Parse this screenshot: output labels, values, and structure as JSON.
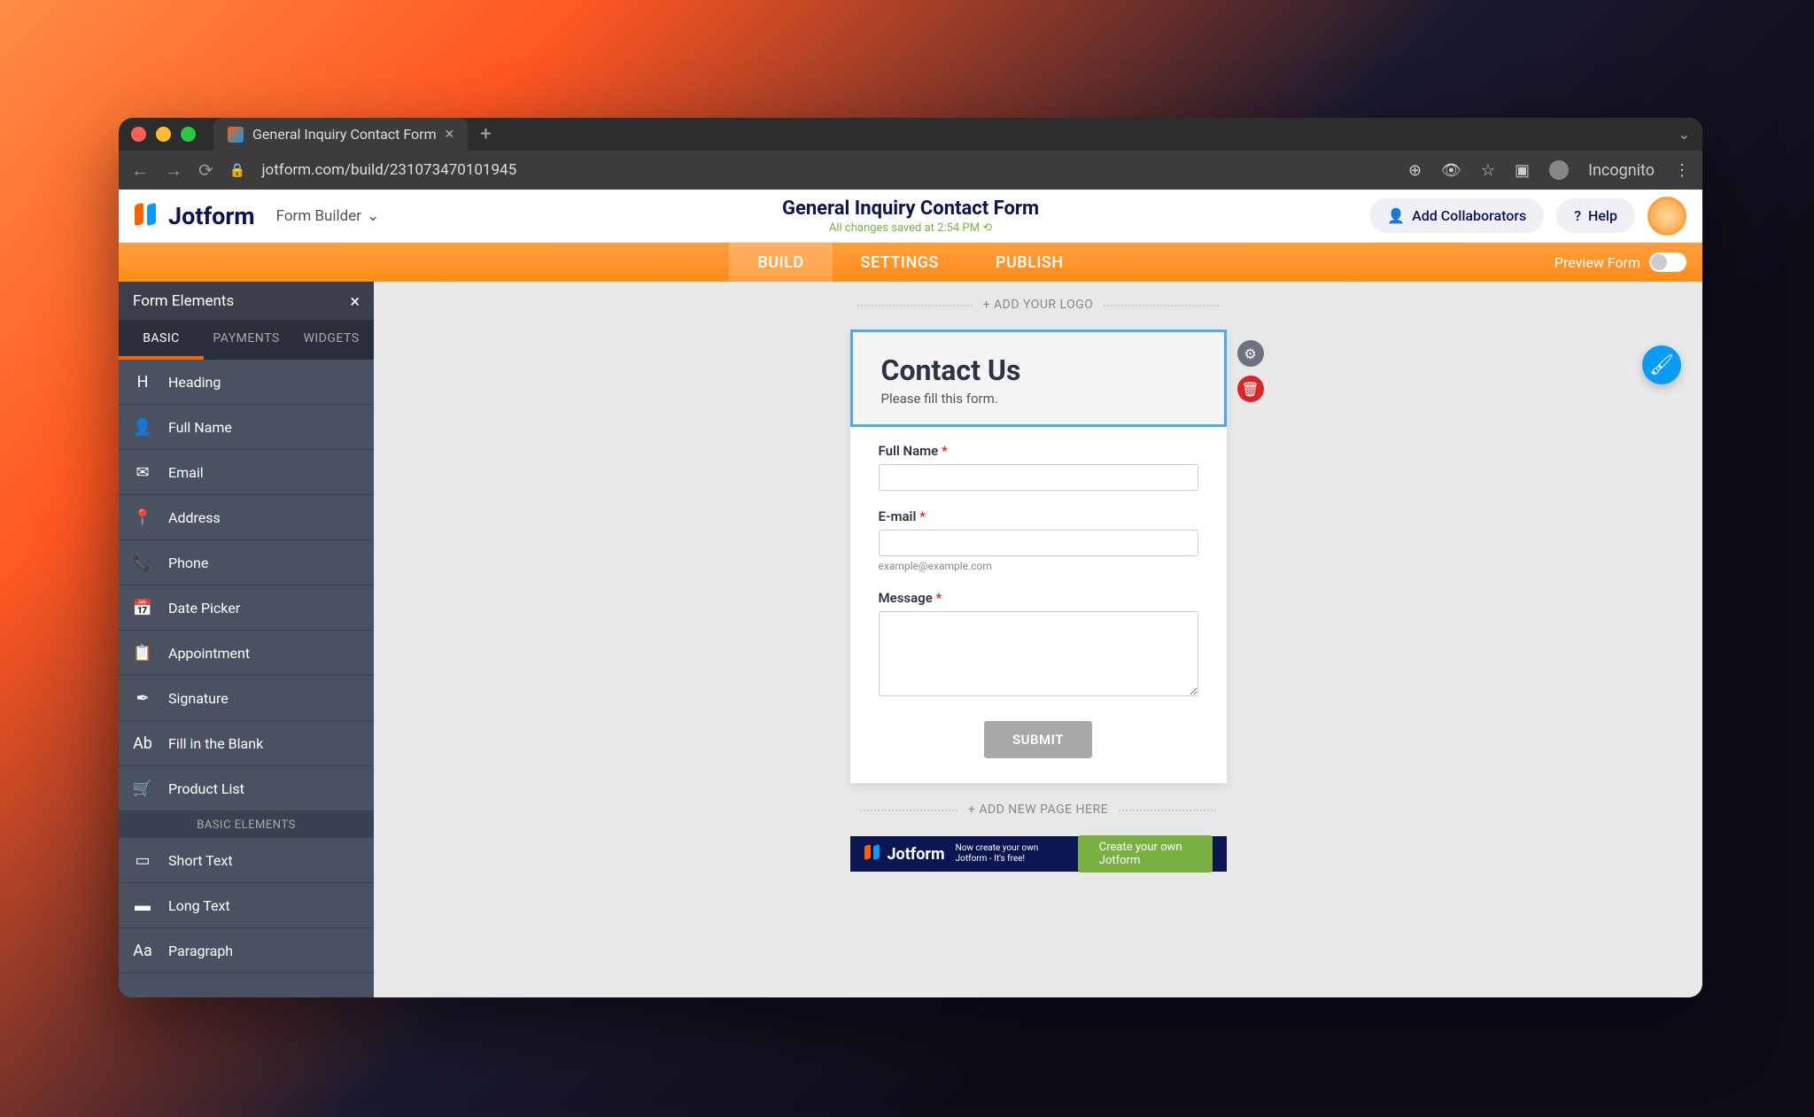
{
  "browser": {
    "tab_title": "General Inquiry Contact Form",
    "url": "jotform.com/build/231073470101945",
    "incognito_label": "Incognito"
  },
  "app": {
    "brand": "Jotform",
    "dropdown": "Form Builder",
    "form_title": "General Inquiry Contact Form",
    "save_msg": "All changes saved at 2:54 PM ⟲",
    "add_collab": "Add Collaborators",
    "help": "Help"
  },
  "tabs": {
    "build": "BUILD",
    "settings": "SETTINGS",
    "publish": "PUBLISH",
    "preview": "Preview Form"
  },
  "sidebar": {
    "title": "Form Elements",
    "tabs": {
      "basic": "BASIC",
      "payments": "PAYMENTS",
      "widgets": "WIDGETS"
    },
    "elements": [
      {
        "icon": "H",
        "label": "Heading"
      },
      {
        "icon": "👤",
        "label": "Full Name"
      },
      {
        "icon": "✉",
        "label": "Email"
      },
      {
        "icon": "📍",
        "label": "Address"
      },
      {
        "icon": "📞",
        "label": "Phone"
      },
      {
        "icon": "📅",
        "label": "Date Picker"
      },
      {
        "icon": "📋",
        "label": "Appointment"
      },
      {
        "icon": "✒",
        "label": "Signature"
      },
      {
        "icon": "Ab",
        "label": "Fill in the Blank"
      },
      {
        "icon": "🛒",
        "label": "Product List"
      }
    ],
    "category": "BASIC ELEMENTS",
    "elements2": [
      {
        "icon": "▭",
        "label": "Short Text"
      },
      {
        "icon": "▬",
        "label": "Long Text"
      },
      {
        "icon": "Aa",
        "label": "Paragraph"
      }
    ]
  },
  "canvas": {
    "add_logo": "+ ADD YOUR LOGO",
    "form": {
      "title": "Contact Us",
      "subtitle": "Please fill this form.",
      "fields": {
        "fullname": {
          "label": "Full Name",
          "required": "*"
        },
        "email": {
          "label": "E-mail",
          "required": "*",
          "hint": "example@example.com"
        },
        "message": {
          "label": "Message",
          "required": "*"
        }
      },
      "submit": "SUBMIT"
    },
    "add_page": "+ ADD NEW PAGE HERE",
    "promo": {
      "brand": "Jotform",
      "msg": "Now create your own Jotform - It's free!",
      "cta": "Create your own Jotform"
    }
  }
}
